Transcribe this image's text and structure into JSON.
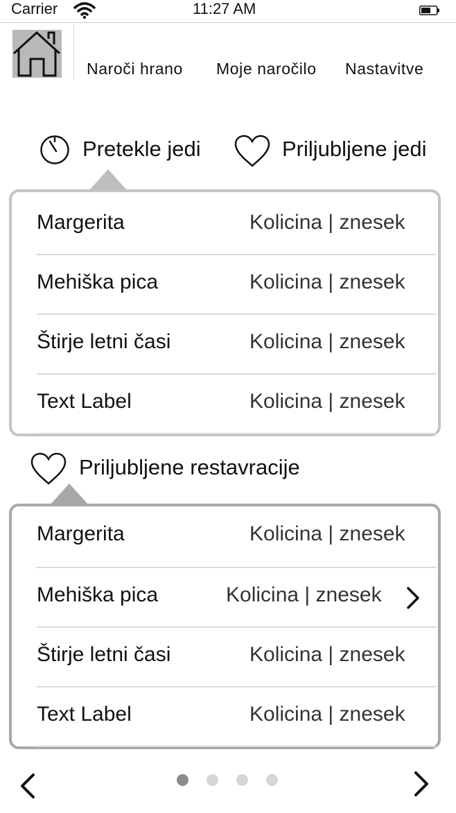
{
  "status_bar": {
    "carrier": "Carrier",
    "time": "11:27 AM"
  },
  "nav": {
    "home_icon": "house-icon",
    "links": [
      "Naroči hrano",
      "Moje naročilo",
      "Nastavitve"
    ]
  },
  "sections": {
    "recent_dishes": {
      "label": "Pretekle jedi",
      "icon": "timer-icon"
    },
    "favorite_dishes": {
      "label": "Priljubljene jedi",
      "icon": "heart-icon"
    },
    "favorite_restaurants": {
      "label": "Priljubljene restavracije",
      "icon": "heart-icon"
    }
  },
  "list1": [
    {
      "name": "Margerita",
      "value": "Kolicina | znesek"
    },
    {
      "name": "Mehiška pica",
      "value": "Kolicina | znesek"
    },
    {
      "name": "Štirje letni časi",
      "value": "Kolicina | znesek"
    },
    {
      "name": "Text Label",
      "value": "Kolicina | znesek"
    }
  ],
  "list2": [
    {
      "name": "Margerita",
      "value": "Kolicina | znesek"
    },
    {
      "name": "Mehiška pica",
      "value": "Kolicina | znesek",
      "chevron": "chevron-right-icon"
    },
    {
      "name": "Štirje letni časi",
      "value": "Kolicina | znesek"
    },
    {
      "name": "Text Label",
      "value": "Kolicina | znesek"
    }
  ],
  "pagination": {
    "pages": 4,
    "active_page": 1
  }
}
